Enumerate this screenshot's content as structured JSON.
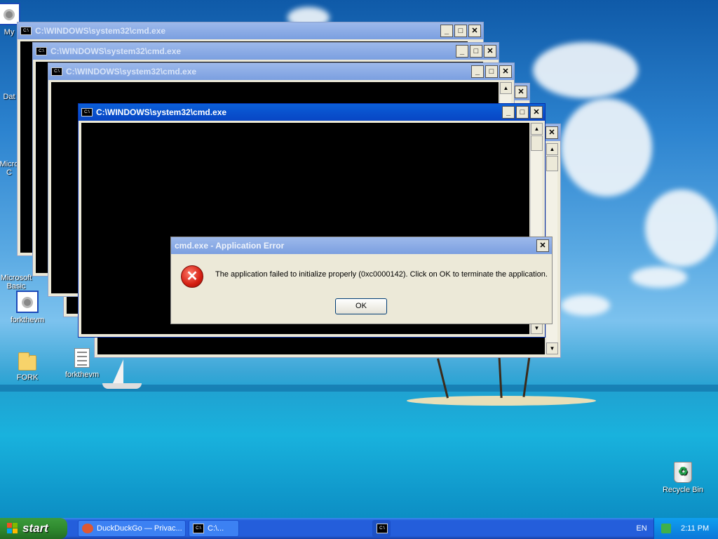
{
  "desktop": {
    "icons": [
      {
        "label": "My"
      },
      {
        "label": "Dat"
      },
      {
        "label": "Micro\nC"
      },
      {
        "label": "Microsoft\nBasic"
      },
      {
        "label": "forkthevm"
      },
      {
        "label": "FORK"
      },
      {
        "label": "forkthevm"
      },
      {
        "label": "Recycle Bin"
      }
    ]
  },
  "windows": [
    {
      "title": "C:\\WINDOWS\\system32\\cmd.exe"
    },
    {
      "title": "C:\\WINDOWS\\system32\\cmd.exe"
    },
    {
      "title": "C:\\WINDOWS\\system32\\cmd.exe"
    },
    {
      "title": "C:\\WINDOWS\\system32\\cmd.exe"
    }
  ],
  "titlebar_icon_text": "C:\\",
  "error_dialog": {
    "title": "cmd.exe - Application Error",
    "message": "The application failed to initialize properly (0xc0000142). Click on OK to terminate the application.",
    "ok_label": "OK",
    "icon": "error-icon"
  },
  "taskbar": {
    "start_label": "start",
    "tasks": [
      {
        "label": "DuckDuckGo — Privac...",
        "icon": "duckduckgo-icon"
      },
      {
        "label": "C:\\...",
        "icon": "cmd-icon"
      },
      {
        "label": "",
        "icon": "cmd-icon"
      }
    ],
    "language": "EN",
    "clock": "2:11 PM"
  },
  "colors": {
    "titlebar_active": "#0845c4",
    "titlebar_inactive": "#7b9fe0",
    "taskbar": "#245edb",
    "start_button": "#2f8a2f"
  }
}
